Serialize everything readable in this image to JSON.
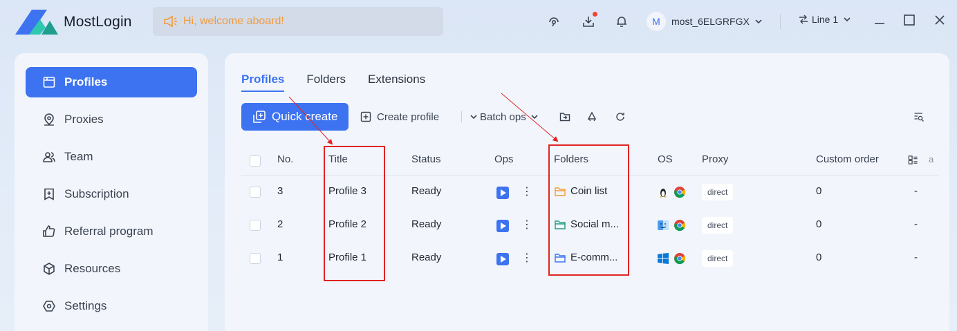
{
  "app": {
    "name": "MostLogin",
    "welcome": "Hi, welcome aboard!",
    "user": {
      "initial": "M",
      "name": "most_6ELGRFGX"
    },
    "line": "Line 1"
  },
  "sidebar": {
    "items": [
      {
        "label": "Profiles",
        "icon": "profiles-icon",
        "active": true
      },
      {
        "label": "Proxies",
        "icon": "location-pin-icon"
      },
      {
        "label": "Team",
        "icon": "team-icon"
      },
      {
        "label": "Subscription",
        "icon": "subscription-icon"
      },
      {
        "label": "Referral program",
        "icon": "thumbs-up-icon"
      },
      {
        "label": "Resources",
        "icon": "cube-icon"
      },
      {
        "label": "Settings",
        "icon": "settings-icon"
      }
    ]
  },
  "main": {
    "tabs": [
      "Profiles",
      "Folders",
      "Extensions"
    ],
    "toolbar": {
      "quick_create": "Quick create",
      "create_profile": "Create profile",
      "batch_ops": "Batch ops"
    },
    "columns": {
      "no": "No.",
      "title": "Title",
      "status": "Status",
      "ops": "Ops",
      "folders": "Folders",
      "os": "OS",
      "proxy": "Proxy",
      "custom_order": "Custom order",
      "truncated": "a"
    },
    "rows": [
      {
        "no": "3",
        "title": "Profile 3",
        "status": "Ready",
        "folder": "Coin list",
        "folder_color": "#f29a3a",
        "os": "linux-icon",
        "proxy": "direct",
        "custom_order": "0",
        "extra": "-"
      },
      {
        "no": "2",
        "title": "Profile 2",
        "status": "Ready",
        "folder": "Social m...",
        "folder_color": "#1f9e7a",
        "os": "macos-icon",
        "proxy": "direct",
        "custom_order": "0",
        "extra": "-"
      },
      {
        "no": "1",
        "title": "Profile 1",
        "status": "Ready",
        "folder": "E-comm...",
        "folder_color": "#3d73f0",
        "os": "windows-icon",
        "proxy": "direct",
        "custom_order": "0",
        "extra": "-"
      }
    ]
  },
  "colors": {
    "accent": "#3d73f0",
    "annotation": "#e02424",
    "welcome_text": "#f29a3a"
  }
}
